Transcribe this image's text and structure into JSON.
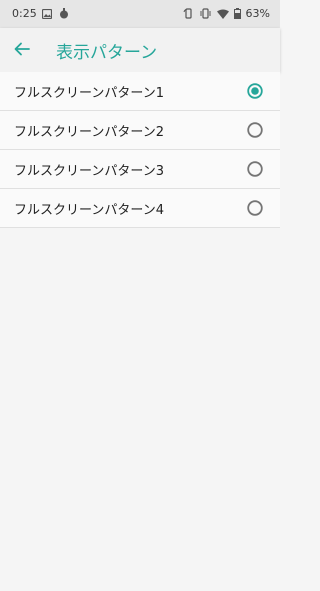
{
  "status_bar": {
    "time": "0:25",
    "battery": "63%",
    "icons": [
      "image-icon",
      "droplet-icon",
      "rotate-icon",
      "vibrate-icon",
      "wifi-icon",
      "battery-icon"
    ]
  },
  "app_bar": {
    "title": "表示パターン",
    "back_icon": "arrow-left-icon"
  },
  "options": [
    {
      "label": "フルスクリーンパターン1",
      "selected": true
    },
    {
      "label": "フルスクリーンパターン2",
      "selected": false
    },
    {
      "label": "フルスクリーンパターン3",
      "selected": false
    },
    {
      "label": "フルスクリーンパターン4",
      "selected": false
    }
  ],
  "colors": {
    "accent": "#26a69a",
    "text": "#212121",
    "radio_unchecked": "#757575",
    "background": "#f5f5f5"
  }
}
